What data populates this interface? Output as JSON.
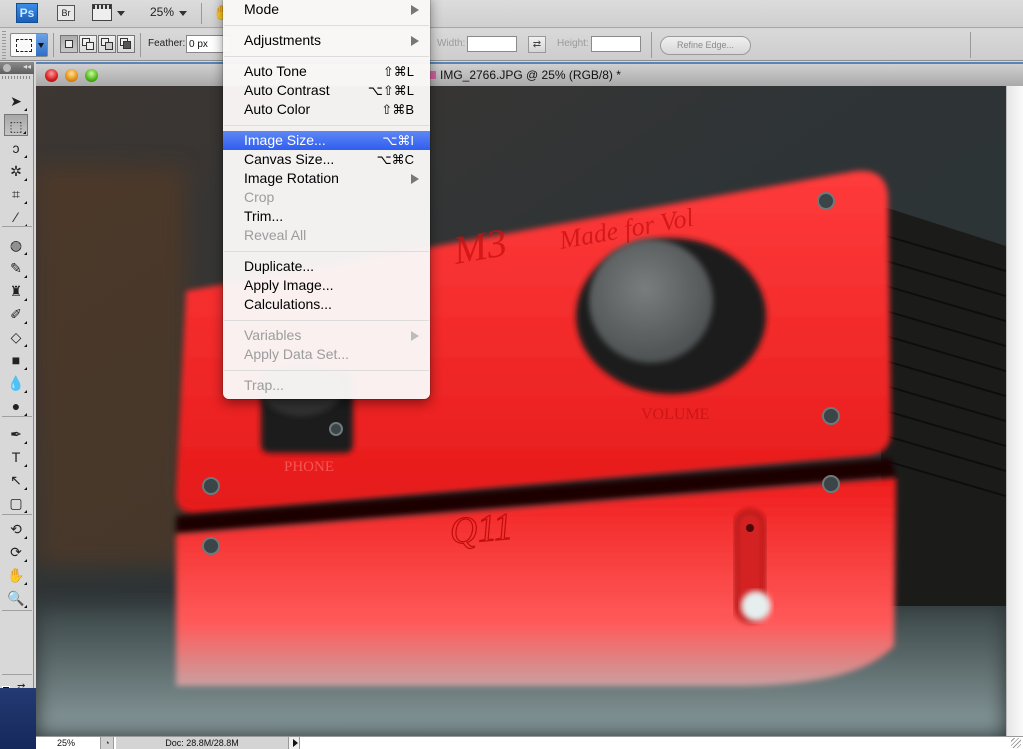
{
  "appbar": {
    "ps_label": "Ps",
    "bridge_label": "Br",
    "zoom_value": "25%",
    "hand_icon": "hand-icon"
  },
  "options": {
    "feather_label": "Feather:",
    "feather_value": "0 px",
    "width_label": "Width:",
    "width_value": "",
    "height_label": "Height:",
    "height_value": "",
    "swap_glyph": "⇄",
    "refine_edge_label": "Refine Edge..."
  },
  "tools": [
    {
      "name": "move-tool",
      "glyph": "➤"
    },
    {
      "name": "rectangular-marquee-tool",
      "glyph": "⬚",
      "active": true
    },
    {
      "name": "lasso-tool",
      "glyph": "ↄ"
    },
    {
      "name": "magic-wand-tool",
      "glyph": "✲"
    },
    {
      "name": "crop-tool",
      "glyph": "⌗"
    },
    {
      "name": "eyedropper-tool",
      "glyph": "⁄"
    },
    {
      "name": "spot-healing-brush-tool",
      "glyph": "◍"
    },
    {
      "name": "brush-tool",
      "glyph": "✎"
    },
    {
      "name": "clone-stamp-tool",
      "glyph": "♜"
    },
    {
      "name": "history-brush-tool",
      "glyph": "✐"
    },
    {
      "name": "eraser-tool",
      "glyph": "◇"
    },
    {
      "name": "gradient-tool",
      "glyph": "■"
    },
    {
      "name": "blur-tool",
      "glyph": "💧"
    },
    {
      "name": "dodge-tool",
      "glyph": "●"
    },
    {
      "name": "pen-tool",
      "glyph": "✒"
    },
    {
      "name": "type-tool",
      "glyph": "T"
    },
    {
      "name": "path-selection-tool",
      "glyph": "↖"
    },
    {
      "name": "rectangle-shape-tool",
      "glyph": "▢"
    },
    {
      "name": "3d-rotate-tool",
      "glyph": "⟲"
    },
    {
      "name": "3d-orbit-tool",
      "glyph": "⟳"
    },
    {
      "name": "hand-tool",
      "glyph": "✋"
    },
    {
      "name": "zoom-tool",
      "glyph": "🔍"
    }
  ],
  "colors": {
    "foreground": "#1f3d1c",
    "background": "#fbeaea",
    "menu_highlight": "#2f5ff0"
  },
  "document": {
    "title": "IMG_2766.JPG @ 25% (RGB/8) *",
    "image_text": {
      "brand": "M3",
      "tagline": "Made for Vol",
      "jack_label": "PHONE",
      "knob_label": "VOLUME",
      "lower_unit": "Q11"
    }
  },
  "status": {
    "zoom": "25%",
    "doc_info": "Doc: 28.8M/28.8M"
  },
  "menu": {
    "items": [
      {
        "label": "Mode",
        "submenu": true
      },
      {
        "sep": true
      },
      {
        "label": "Adjustments",
        "submenu": true
      },
      {
        "sep": true
      },
      {
        "label": "Auto Tone",
        "shortcut": "⇧⌘L"
      },
      {
        "label": "Auto Contrast",
        "shortcut": "⌥⇧⌘L"
      },
      {
        "label": "Auto Color",
        "shortcut": "⇧⌘B"
      },
      {
        "sep": true
      },
      {
        "label": "Image Size...",
        "shortcut": "⌥⌘I",
        "highlighted": true
      },
      {
        "label": "Canvas Size...",
        "shortcut": "⌥⌘C"
      },
      {
        "label": "Image Rotation",
        "submenu": true
      },
      {
        "label": "Crop",
        "disabled": true
      },
      {
        "label": "Trim..."
      },
      {
        "label": "Reveal All",
        "disabled": true
      },
      {
        "sep": true
      },
      {
        "label": "Duplicate..."
      },
      {
        "label": "Apply Image..."
      },
      {
        "label": "Calculations..."
      },
      {
        "sep": true
      },
      {
        "label": "Variables",
        "submenu": true,
        "disabled": true
      },
      {
        "label": "Apply Data Set...",
        "disabled": true
      },
      {
        "sep": true
      },
      {
        "label": "Trap...",
        "disabled": true
      }
    ]
  }
}
